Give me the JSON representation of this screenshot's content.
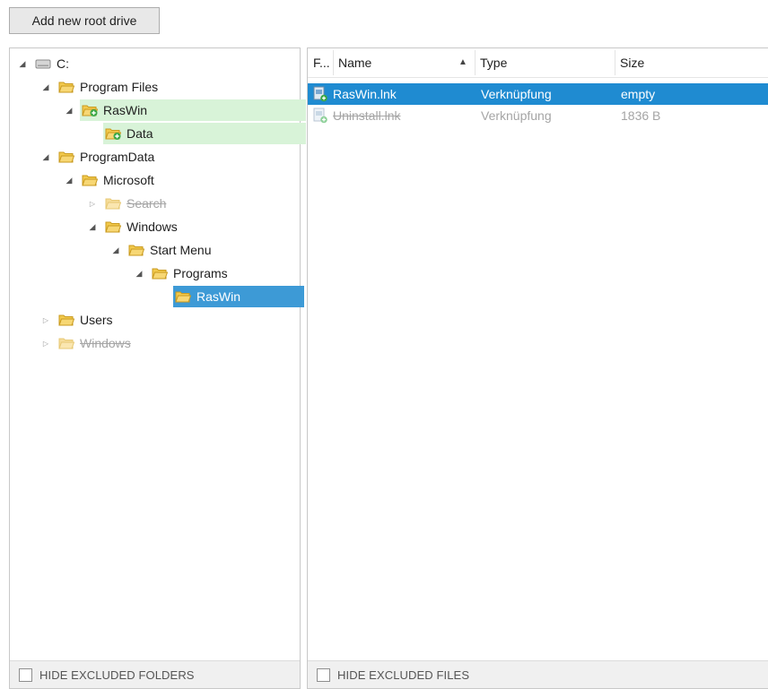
{
  "toolbar": {
    "add_root_drive": "Add new root drive"
  },
  "tree": {
    "items": [
      {
        "label": "C:",
        "icon": "drive-icon",
        "state": "expanded",
        "style": "normal"
      },
      {
        "label": "Program Files",
        "icon": "folder-icon",
        "state": "expanded",
        "style": "normal"
      },
      {
        "label": "RasWin",
        "icon": "folder-plus-icon",
        "state": "expanded",
        "style": "included"
      },
      {
        "label": "Data",
        "icon": "folder-plus-icon",
        "state": "leaf",
        "style": "included"
      },
      {
        "label": "ProgramData",
        "icon": "folder-icon",
        "state": "expanded",
        "style": "normal"
      },
      {
        "label": "Microsoft",
        "icon": "folder-icon",
        "state": "expanded",
        "style": "normal"
      },
      {
        "label": "Search",
        "icon": "folder-icon",
        "state": "collapsed",
        "style": "excluded"
      },
      {
        "label": "Windows",
        "icon": "folder-icon",
        "state": "expanded",
        "style": "normal"
      },
      {
        "label": "Start Menu",
        "icon": "folder-icon",
        "state": "expanded",
        "style": "normal"
      },
      {
        "label": "Programs",
        "icon": "folder-icon",
        "state": "expanded",
        "style": "normal"
      },
      {
        "label": "RasWin",
        "icon": "folder-icon",
        "state": "leaf",
        "style": "selected"
      },
      {
        "label": "Users",
        "icon": "folder-icon",
        "state": "collapsed",
        "style": "normal"
      },
      {
        "label": "Windows",
        "icon": "folder-icon",
        "state": "collapsed",
        "style": "excluded"
      }
    ],
    "footer_label": "HIDE EXCLUDED FOLDERS"
  },
  "files": {
    "columns": [
      "F...",
      "Name",
      "Type",
      "Size"
    ],
    "sort_column": "Name",
    "rows": [
      {
        "name": "RasWin.lnk",
        "type": "Verknüpfung",
        "size": "empty",
        "state": "selected"
      },
      {
        "name": "Uninstall.lnk",
        "type": "Verknüpfung",
        "size": "1836 B",
        "state": "excluded"
      }
    ],
    "footer_label": "HIDE EXCLUDED FILES"
  },
  "colors": {
    "selection_blue": "#3d9ad6",
    "grid_selection": "#1f8bd1",
    "included_green": "#d8f3d8",
    "folder_yellow": "#f2c94c",
    "plus_green": "#3aa845"
  }
}
